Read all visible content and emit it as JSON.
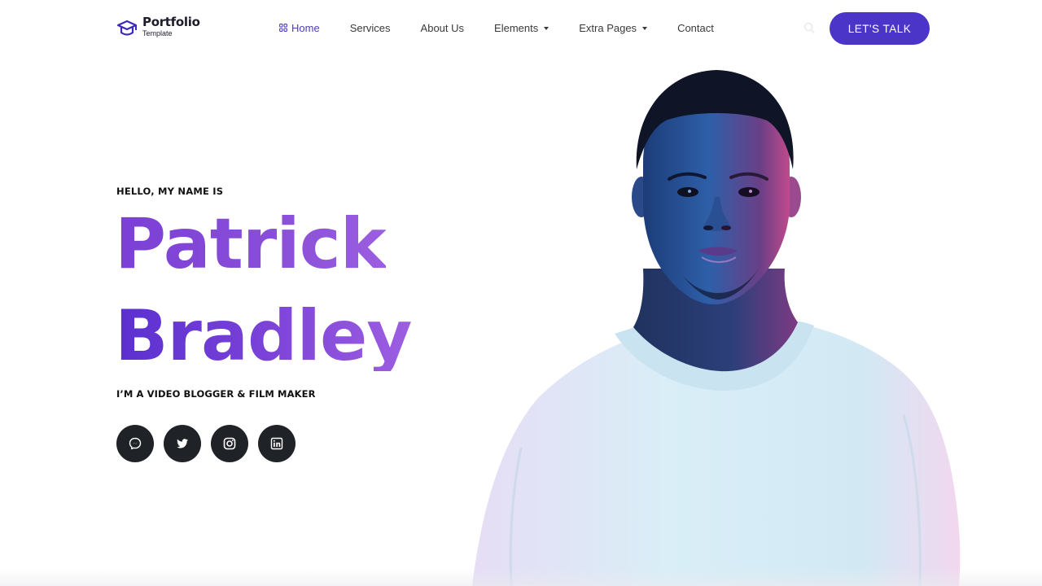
{
  "brand": {
    "title": "Portfolio",
    "subtitle": "Template",
    "icon": "graduation-cap-icon"
  },
  "nav": {
    "items": [
      {
        "label": "Home",
        "active": true,
        "icon": "grid-icon"
      },
      {
        "label": "Services"
      },
      {
        "label": "About Us"
      },
      {
        "label": "Elements",
        "dropdown": true
      },
      {
        "label": "Extra Pages",
        "dropdown": true
      },
      {
        "label": "Contact"
      }
    ],
    "search_icon": "search-icon",
    "cta_label": "LET'S TALK"
  },
  "hero": {
    "greeting": "HELLO, MY NAME IS",
    "first_name": "Patrick",
    "last_name": "Bradley",
    "tagline": "I’M A VIDEO BLOGGER & FILM MAKER",
    "socials": [
      {
        "name": "messenger-icon"
      },
      {
        "name": "twitter-icon"
      },
      {
        "name": "instagram-icon"
      },
      {
        "name": "linkedin-icon"
      }
    ],
    "portrait": "person-portrait"
  },
  "colors": {
    "accent": "#4b35c9",
    "active_nav": "#4e3bc3",
    "name_gradient_start": "#5a2fd0",
    "name_gradient_end": "#9d5fe1",
    "social_bg": "#1f2226"
  }
}
